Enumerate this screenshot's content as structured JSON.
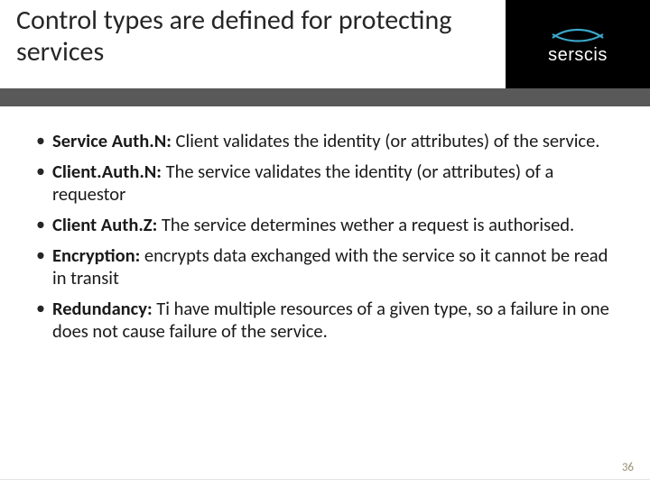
{
  "header": {
    "title": "Control types are defined for protecting services",
    "logo_text": "serscis"
  },
  "bullets": [
    {
      "label": "Service Auth.N:",
      "text": " Client validates the identity (or attributes) of the service."
    },
    {
      "label": "Client.Auth.N:",
      "text": " The service validates the identity (or attributes) of a requestor"
    },
    {
      "label": "Client Auth.Z:",
      "text": " The service determines wether a request is authorised."
    },
    {
      "label": "Encryption:",
      "text": " encrypts data exchanged with the service so it cannot be read in transit"
    },
    {
      "label": "Redundancy:",
      "text": "  Ti have multiple resources of a given type, so a failure in one does not cause failure of the service."
    }
  ],
  "page_number": "36"
}
